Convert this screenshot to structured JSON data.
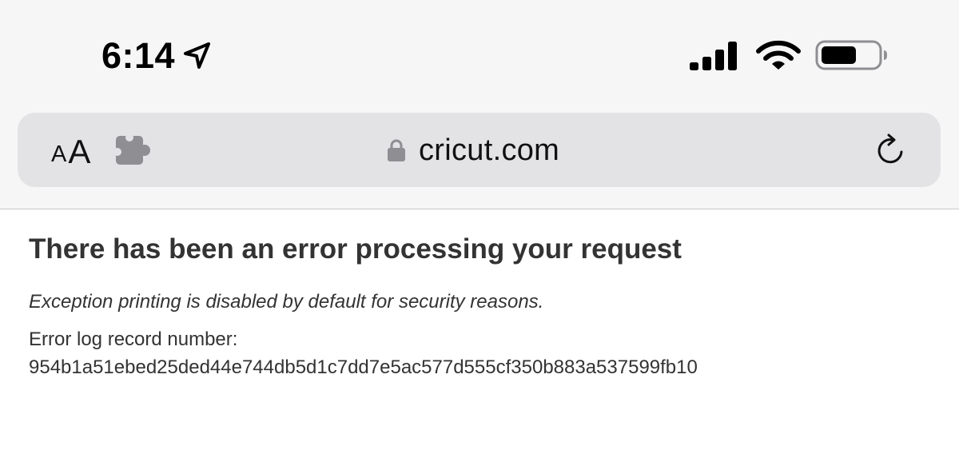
{
  "status_bar": {
    "time": "6:14",
    "icons": [
      "location-arrow-icon",
      "cellular-signal-icon",
      "wifi-icon",
      "battery-icon"
    ]
  },
  "address_bar": {
    "text_size_small": "A",
    "text_size_large": "A",
    "extension_icon": "puzzle-piece-icon",
    "secure_icon": "lock-icon",
    "url": "cricut.com",
    "reload_icon": "reload-icon"
  },
  "page": {
    "title": "There has been an error processing your request",
    "note": "Exception printing is disabled by default for security reasons.",
    "log_label": "Error log record number:",
    "log_number": "954b1a51ebed25ded44e744db5d1c7dd7e5ac577d555cf350b883a537599fb10"
  },
  "colors": {
    "chrome_background": "#f6f6f6",
    "address_bar_background": "#e3e3e5",
    "icon_gray": "#8e8e93",
    "text_dark": "#333333"
  }
}
